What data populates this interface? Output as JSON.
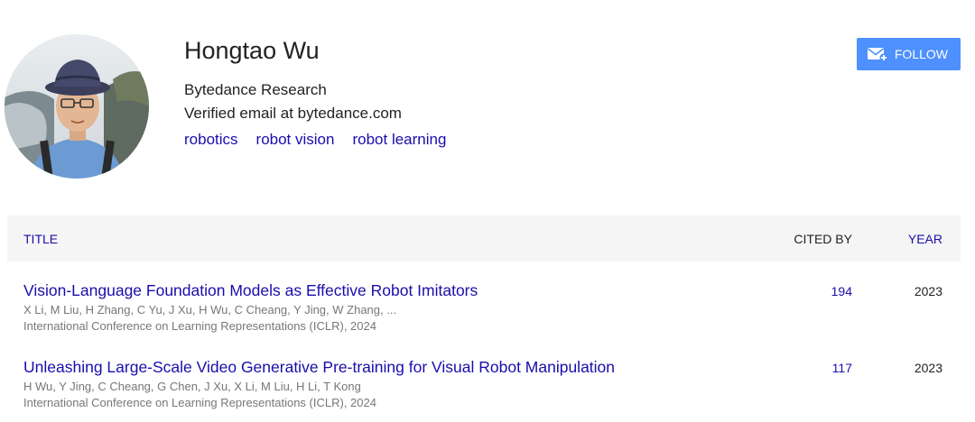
{
  "profile": {
    "name": "Hongtao Wu",
    "affiliation": "Bytedance Research",
    "email": "Verified email at bytedance.com",
    "interests": [
      "robotics",
      "robot vision",
      "robot learning"
    ],
    "follow_label": "FOLLOW",
    "follow_icon": "envelope-plus-icon",
    "accent_color": "#4d90fe"
  },
  "table": {
    "headers": {
      "title": "TITLE",
      "cited_by": "CITED BY",
      "year": "YEAR"
    },
    "rows": [
      {
        "title": "Vision-Language Foundation Models as Effective Robot Imitators",
        "authors": "X Li, M Liu, H Zhang, C Yu, J Xu, H Wu, C Cheang, Y Jing, W Zhang, ...",
        "venue": "International Conference on Learning Representations (ICLR), 2024",
        "cited_by": "194",
        "year": "2023"
      },
      {
        "title": "Unleashing Large-Scale Video Generative Pre-training for Visual Robot Manipulation",
        "authors": "H Wu, Y Jing, C Cheang, G Chen, J Xu, X Li, M Liu, H Li, T Kong",
        "venue": "International Conference on Learning Representations (ICLR), 2024",
        "cited_by": "117",
        "year": "2023"
      }
    ]
  }
}
